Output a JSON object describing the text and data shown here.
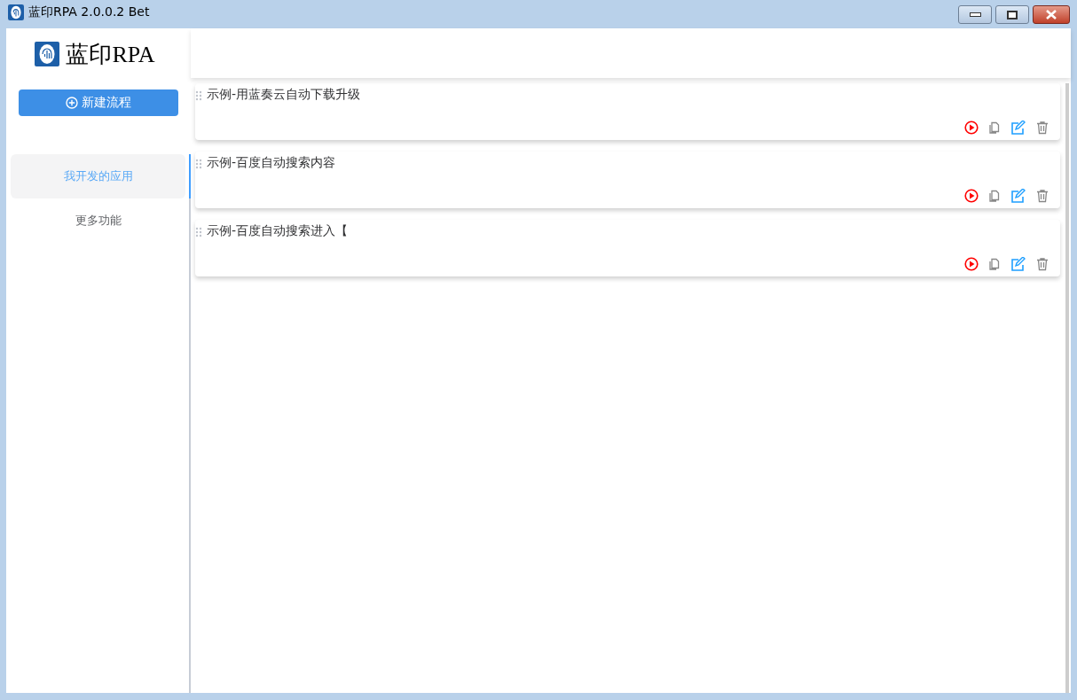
{
  "window": {
    "title": "蓝印RPA 2.0.0.2 Bet"
  },
  "sidebar": {
    "logo_text": "蓝印RPA",
    "new_button": "新建流程",
    "items": [
      {
        "label": "我开发的应用",
        "selected": true
      },
      {
        "label": "更多功能",
        "selected": false
      }
    ]
  },
  "flows": [
    {
      "title": "示例-用蓝奏云自动下载升级"
    },
    {
      "title": "示例-百度自动搜索内容"
    },
    {
      "title": "示例-百度自动搜索进入【"
    }
  ]
}
